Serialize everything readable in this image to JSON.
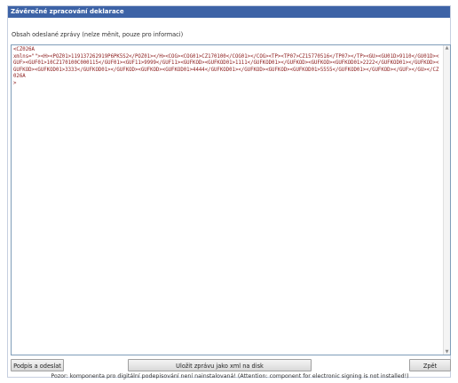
{
  "window": {
    "title": "Závěrečné zpracování deklarace"
  },
  "message": {
    "label": "Obsah odeslané zprávy (nelze měnit, pouze pro informaci)",
    "content": "<CZ026A\nxmlns=\"\"><H><POZ01>119137262919P6PK5S2</POZ01></H><COG><COG01>CZ170100</COG01></COG><TP><TP07>CZ15770516</TP07></TP><GU><GU01D>9110</GU01D><GUF><GUF01>10CZ170100C000115</GUF01><GUF11>9999</GUF11><GUFKOD><GUFKOD01>1111</GUFKOD01></GUFKOD><GUFKOD><GUFKOD01>2222</GUFKOD01></GUFKOD><GUFKOD><GUFKOD01>3333</GUFKOD01></GUFKOD><GUFKOD><GUFKOD01>4444</GUFKOD01></GUFKOD><GUFKOD><GUFKOD01>5555</GUFKOD01></GUFKOD></GUF></GU></CZ026A\n>"
  },
  "buttons": {
    "sign_send": "Podpis a odeslat",
    "save_xml": "Uložit zprávu jako xml na disk",
    "back": "Zpět"
  },
  "warning": "Pozor: komponenta pro digitální podepisování není nainstalovaná! (Attention: component for electronic signing is not installed!)"
}
